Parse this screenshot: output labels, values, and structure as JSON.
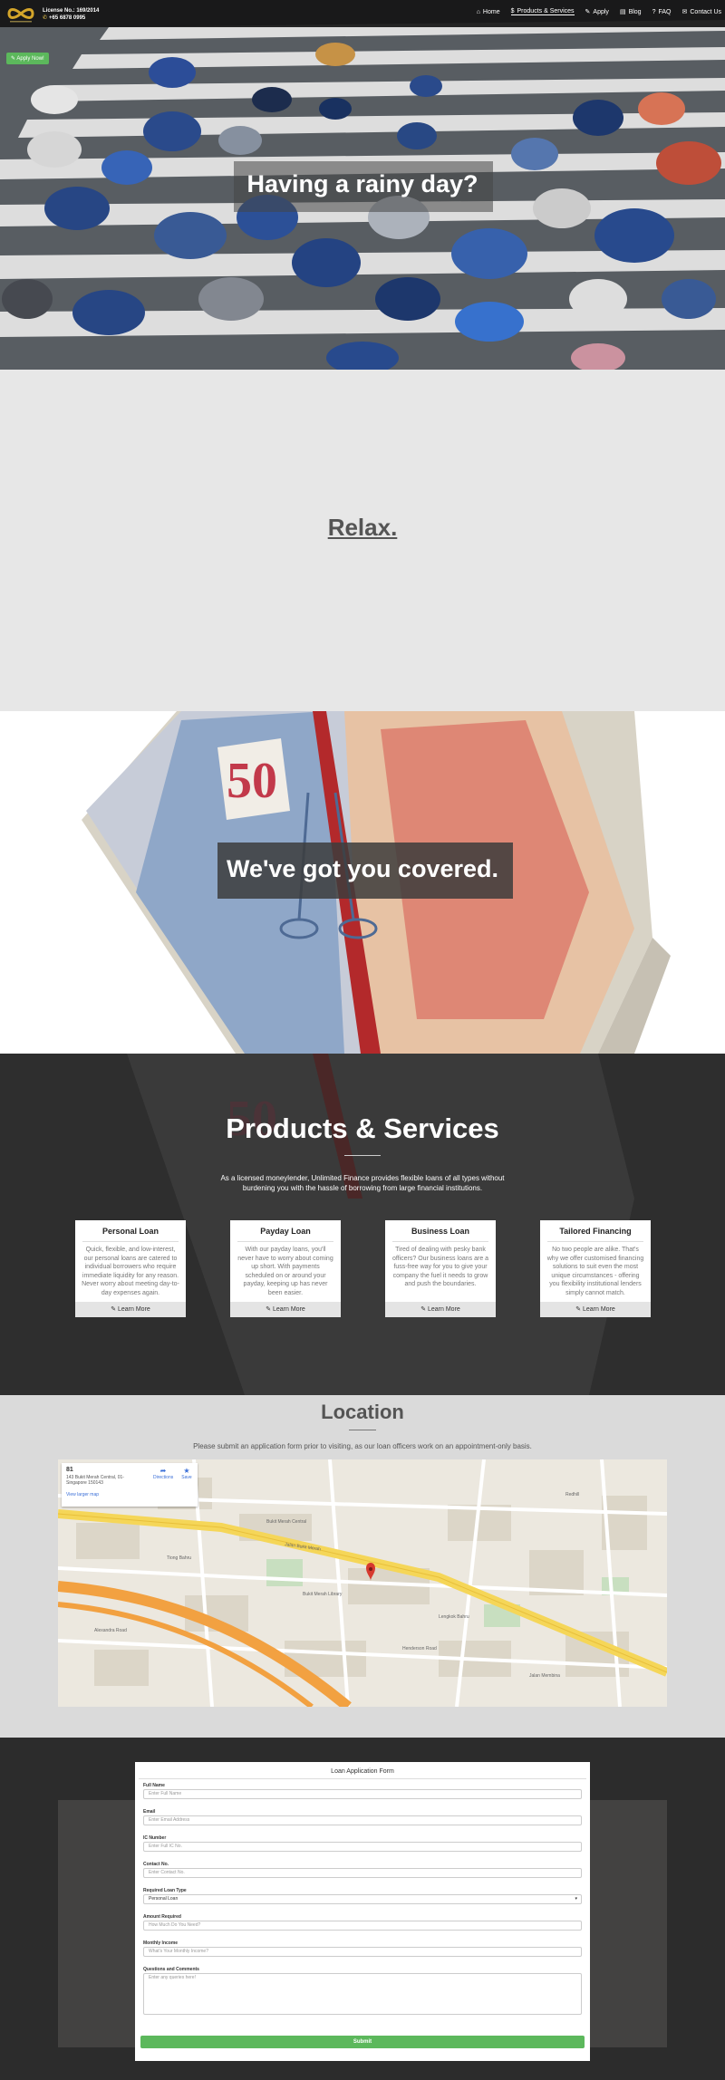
{
  "navbar": {
    "license": "License No.: 169/2014",
    "phone": "+65 6878 0995",
    "items": [
      {
        "label": "Home",
        "icon": "home-icon"
      },
      {
        "label": "Products & Services",
        "icon": "dollar-icon"
      },
      {
        "label": "Apply",
        "icon": "edit-icon"
      },
      {
        "label": "Blog",
        "icon": "blog-icon"
      },
      {
        "label": "FAQ",
        "icon": "question-icon"
      },
      {
        "label": "Contact Us",
        "icon": "envelope-icon"
      }
    ]
  },
  "hero": {
    "apply_button": "Apply Now!",
    "title": "Having a rainy day?"
  },
  "relax": {
    "title": "Relax."
  },
  "covered": {
    "title": "We've got you covered."
  },
  "products": {
    "title": "Products & Services",
    "description": "As a licensed moneylender, Unlimited Finance provides flexible loans of all types without burdening you with the hassle of borrowing from large financial institutions.",
    "cards": [
      {
        "title": "Personal Loan",
        "text": "Quick, flexible, and low-interest, our personal loans are catered to individual borrowers who require immediate liquidity for any reason. Never worry about meeting day-to-day expenses again.",
        "button": "Learn More"
      },
      {
        "title": "Payday Loan",
        "text": "With our payday loans, you'll never have to worry about coming up short. With payments scheduled on or around your payday, keeping up has never been easier.",
        "button": "Learn More"
      },
      {
        "title": "Business Loan",
        "text": "Tired of dealing with pesky bank officers? Our business loans are a fuss-free way for you to give your company the fuel it needs to grow and push the boundaries.",
        "button": "Learn More"
      },
      {
        "title": "Tailored Financing",
        "text": "No two people are alike. That's why we offer customised financing solutions to suit even the most unique circumstances - offering you flexibility institutional lenders simply cannot match.",
        "button": "Learn More"
      }
    ]
  },
  "location": {
    "title": "Location",
    "description": "Please submit an application form prior to visiting, as our loan officers work on an appointment-only basis.",
    "map_card": {
      "number": "81",
      "address": "143 Bukit Merah Central, 01-\nSingapore 150143",
      "larger_map": "View larger map",
      "directions": "Directions",
      "save": "Save"
    },
    "streets": [
      "Jalan Bukit Merah",
      "Bukit Merah Central",
      "Redhill",
      "Tiong Bahru",
      "Henderson Road",
      "Alexandra Road",
      "Bukit Merah Library",
      "Lengkok Bahru",
      "Jalan Membina"
    ]
  },
  "form": {
    "title": "Loan Application Form",
    "fields": [
      {
        "label": "Full Name",
        "placeholder": "Enter Full Name"
      },
      {
        "label": "Email",
        "placeholder": "Enter Email Address"
      },
      {
        "label": "IC Number",
        "placeholder": "Enter Full IC No."
      },
      {
        "label": "Contact No.",
        "placeholder": "Enter Contact No."
      },
      {
        "label": "Required Loan Type",
        "value": "Personal Loan"
      },
      {
        "label": "Amount Required",
        "placeholder": "How Much Do You Need?"
      },
      {
        "label": "Monthly Income",
        "placeholder": "What's Your Monthly Income?"
      },
      {
        "label": "Questions and Comments",
        "placeholder": "Enter any queries here!"
      }
    ],
    "submit": "Submit"
  },
  "colors": {
    "accent_green": "#5cb85c",
    "navbar_bg": "#141414",
    "dark_section": "#2e2e2e",
    "logo_gold": "#d4a52a"
  }
}
